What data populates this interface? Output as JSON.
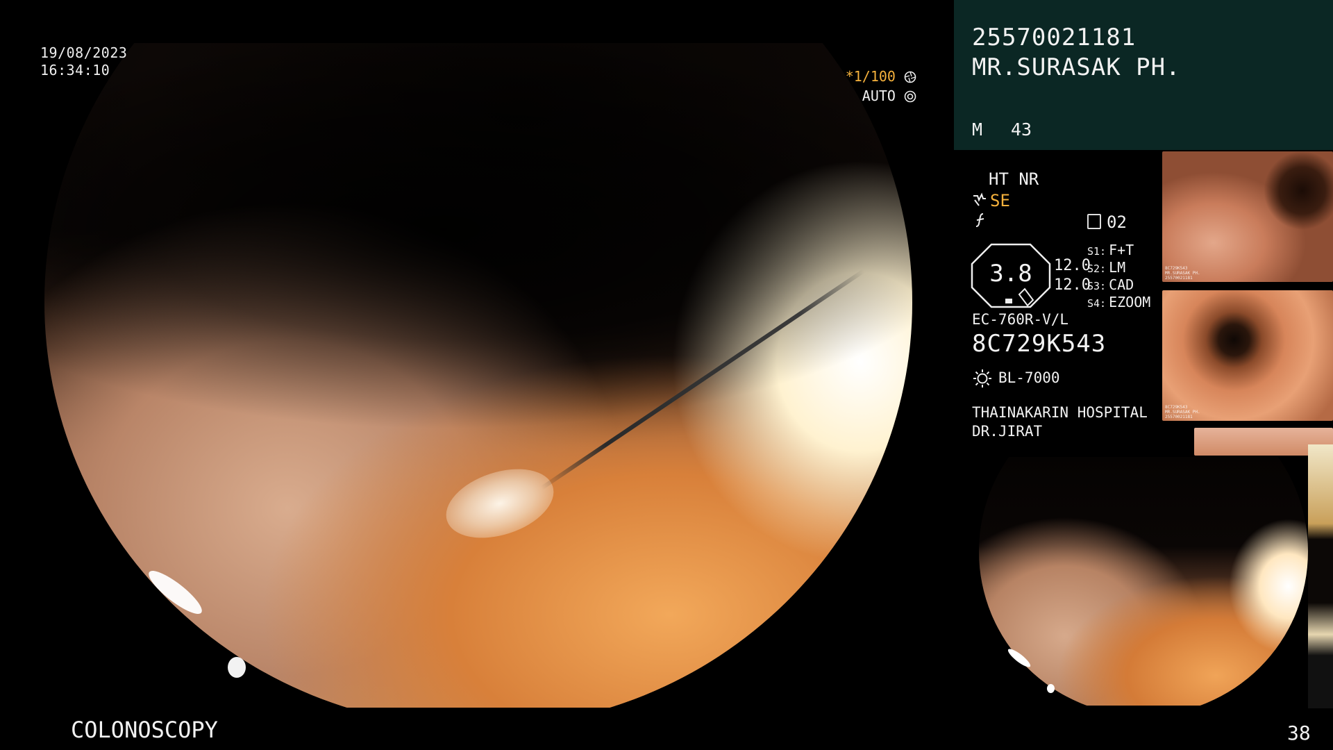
{
  "datetime": {
    "date": "19/08/2023",
    "time": "16:34:10"
  },
  "shutter": {
    "star": "*",
    "value": "1/100",
    "icon": "shutter-icon"
  },
  "iris": {
    "mode": "AUTO",
    "icon": "iris-icon"
  },
  "patient": {
    "id": "25570021181",
    "name": "MR.SURASAK PH.",
    "sex": "M",
    "age": "43"
  },
  "settings": {
    "structure_enhance": "HT NR",
    "se_label": "SE",
    "mode_value": "02",
    "zoom_value": "3.8",
    "zoom_readout_1": "12.0",
    "zoom_readout_2": "12.0",
    "switches": [
      {
        "key": "S1:",
        "value": "F+T"
      },
      {
        "key": "S2:",
        "value": "LM"
      },
      {
        "key": "S3:",
        "value": "CAD"
      },
      {
        "key": "S4:",
        "value": "EZOOM"
      }
    ]
  },
  "scope": {
    "model": "EC-760R-V/L",
    "serial": "8C729K543"
  },
  "light_source": {
    "model": "BL-7000",
    "icon": "light-source-icon"
  },
  "facility": {
    "hospital": "THAINAKARIN HOSPITAL",
    "doctor": "DR.JIRAT"
  },
  "thumbnails": [
    {
      "caption_1": "8C729K543",
      "caption_2": "MR.SURASAK PH.",
      "caption_3": "25570021181"
    },
    {
      "caption_1": "8C729K543",
      "caption_2": "MR.SURASAK PH.",
      "caption_3": "25570021181"
    }
  ],
  "footer": {
    "exam_type": "COLONOSCOPY",
    "image_counter": "38"
  }
}
